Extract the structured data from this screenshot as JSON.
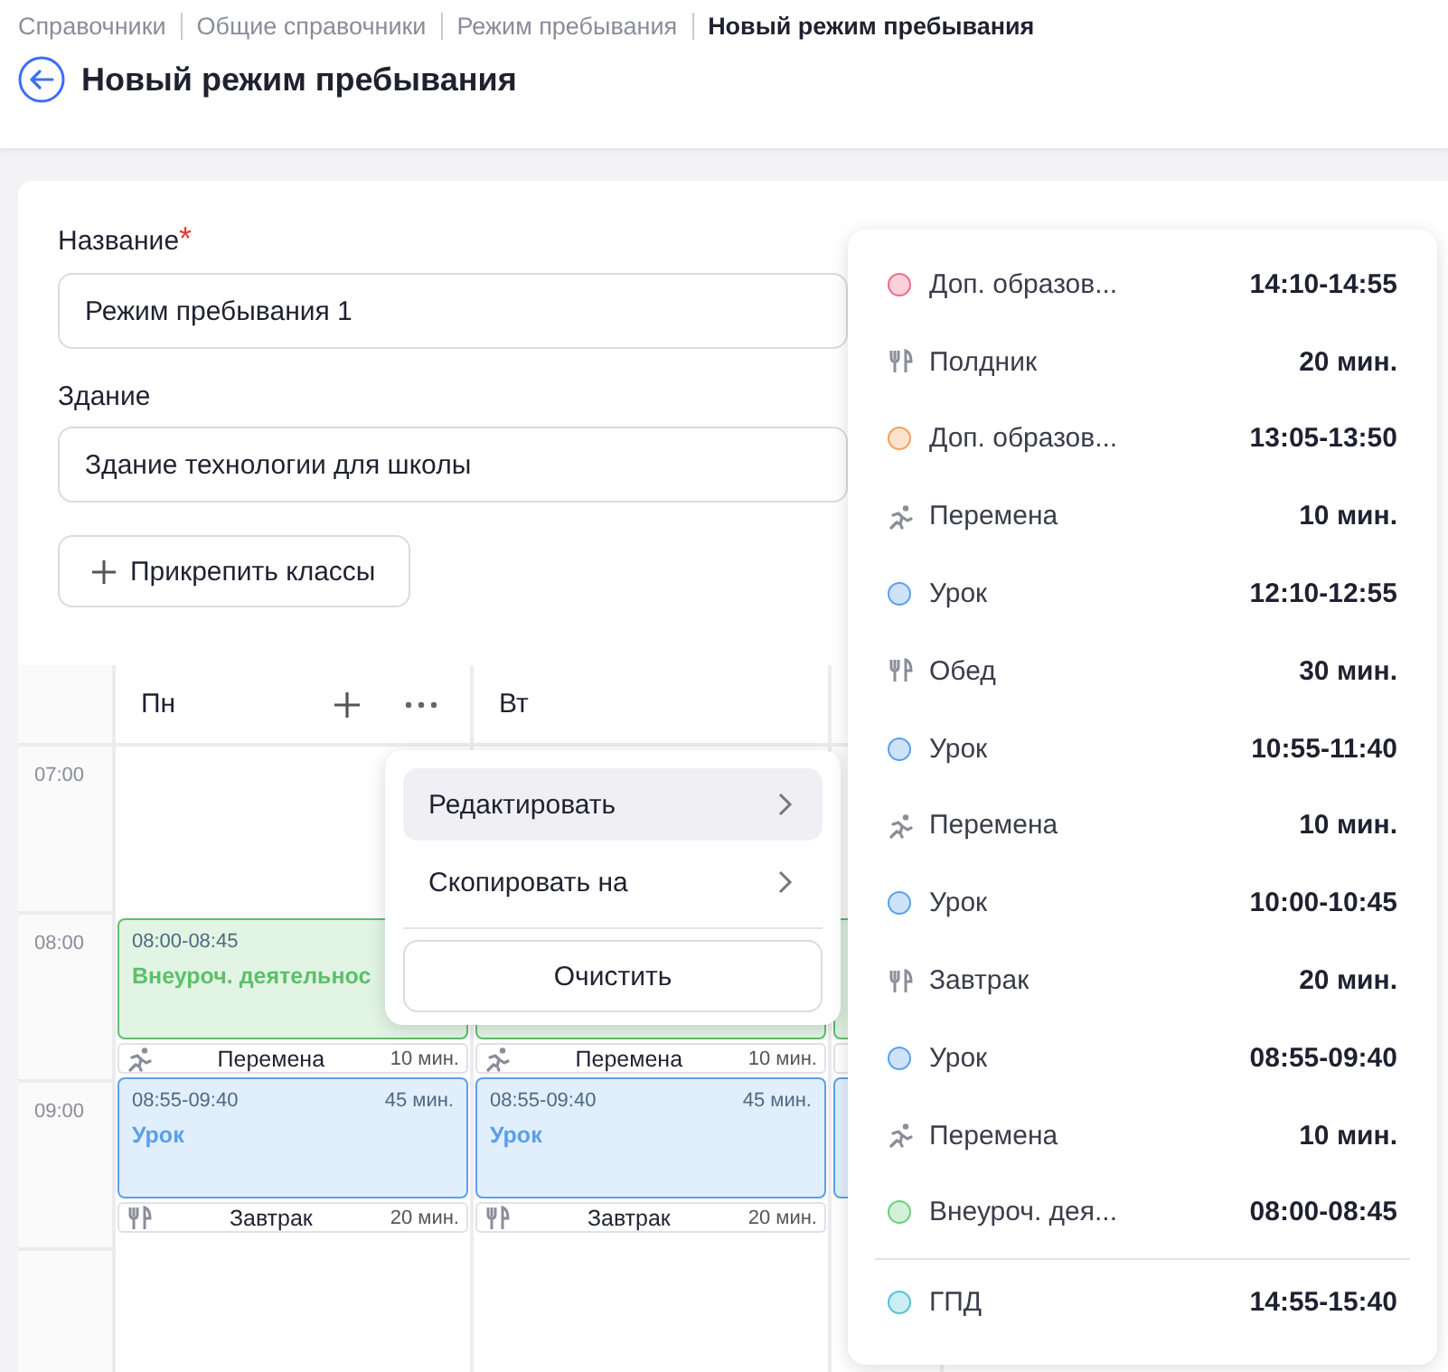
{
  "breadcrumbs": [
    {
      "label": "Справочники",
      "current": false
    },
    {
      "label": "Общие справочники",
      "current": false
    },
    {
      "label": "Режим пребывания",
      "current": false
    },
    {
      "label": "Новый режим пребывания",
      "current": true
    }
  ],
  "title": "Новый режим пребывания",
  "form": {
    "name_label": "Название",
    "required_mark": "*",
    "name_value": "Режим пребывания 1",
    "building_label": "Здание",
    "building_value": "Здание технологии для школы",
    "attach_button": "Прикрепить классы"
  },
  "schedule": {
    "times": [
      "07:00",
      "08:00",
      "09:00"
    ],
    "days": [
      {
        "label": "Пн",
        "actions": true,
        "items": [
          {
            "kind": "event",
            "time": "08:00-08:45",
            "title": "Внеуроч. деятельнос",
            "color": "#5cc06a"
          },
          {
            "kind": "run",
            "title": "Перемена",
            "duration": "10 мин."
          },
          {
            "kind": "event",
            "time": "08:55-09:40",
            "duration": "45 мин.",
            "title": "Урок",
            "color": "#5aa0e8"
          },
          {
            "kind": "meal",
            "title": "Завтрак",
            "duration": "20 мин."
          }
        ]
      },
      {
        "label": "Вт",
        "actions": false,
        "items": [
          {
            "kind": "event",
            "color": "#5cc06a"
          },
          {
            "kind": "run",
            "title": "Перемена",
            "duration": "10 мин."
          },
          {
            "kind": "event",
            "time": "08:55-09:40",
            "duration": "45 мин.",
            "title": "Урок",
            "color": "#5aa0e8"
          },
          {
            "kind": "meal",
            "title": "Завтрак",
            "duration": "20 мин."
          }
        ]
      }
    ]
  },
  "context_menu": {
    "items": [
      {
        "label": "Редактировать",
        "selected": true
      },
      {
        "label": "Скопировать на",
        "selected": false
      }
    ],
    "clear_button": "Очистить"
  },
  "legend": {
    "items": [
      {
        "kind": "dot",
        "label": "Доп. образов...",
        "value": "14:10-14:55",
        "color": "#f06a8a"
      },
      {
        "kind": "meal",
        "label": "Полдник",
        "value": "20 мин."
      },
      {
        "kind": "dot",
        "label": "Доп. образов...",
        "value": "13:05-13:50",
        "color": "#f5a05a"
      },
      {
        "kind": "run",
        "label": "Перемена",
        "value": "10 мин."
      },
      {
        "kind": "dot",
        "label": "Урок",
        "value": "12:10-12:55",
        "color": "#5aa0e8"
      },
      {
        "kind": "meal",
        "label": "Обед",
        "value": "30 мин."
      },
      {
        "kind": "dot",
        "label": "Урок",
        "value": "10:55-11:40",
        "color": "#5aa0e8"
      },
      {
        "kind": "run",
        "label": "Перемена",
        "value": "10 мин."
      },
      {
        "kind": "dot",
        "label": "Урок",
        "value": "10:00-10:45",
        "color": "#5aa0e8"
      },
      {
        "kind": "meal",
        "label": "Завтрак",
        "value": "20 мин."
      },
      {
        "kind": "dot",
        "label": "Урок",
        "value": "08:55-09:40",
        "color": "#5aa0e8"
      },
      {
        "kind": "run",
        "label": "Перемена",
        "value": "10 мин."
      },
      {
        "kind": "dot",
        "label": "Внеуроч. дея...",
        "value": "08:00-08:45",
        "color": "#6cd07a"
      }
    ],
    "pinned": [
      {
        "kind": "dot",
        "label": "ГПД",
        "value": "14:55-15:40",
        "color": "#56c2d6"
      }
    ]
  }
}
